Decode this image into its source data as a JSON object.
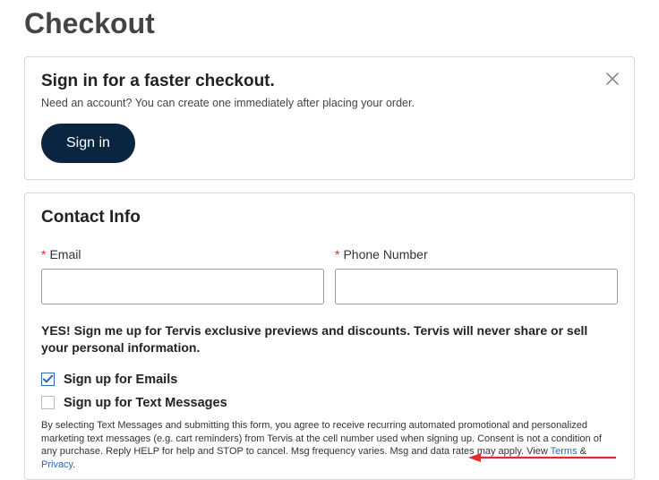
{
  "page_title": "Checkout",
  "signin_panel": {
    "title": "Sign in for a faster checkout.",
    "subtitle": "Need an account? You can create one immediately after placing your order.",
    "button_label": "Sign in"
  },
  "contact": {
    "section_title": "Contact Info",
    "required_mark": "*",
    "email": {
      "label": "Email",
      "value": ""
    },
    "phone": {
      "label": "Phone Number",
      "value": ""
    }
  },
  "optin": {
    "heading": "YES! Sign me up for Tervis exclusive previews and discounts. Tervis will never share or sell your personal information.",
    "email_label": "Sign up for Emails",
    "email_checked": true,
    "text_label": "Sign up for Text Messages",
    "text_checked": false,
    "legal_pre": "By selecting Text Messages and submitting this form, you agree to receive recurring automated promotional and personalized marketing text messages (e.g. cart reminders) from Tervis at the cell number used when signing up. Consent is not a condition of any purchase. Reply HELP for help and STOP to cancel. Msg frequency varies. Msg and data rates may apply. View ",
    "terms_label": "Terms",
    "amp": " & ",
    "privacy_label": "Privacy",
    "legal_post": "."
  },
  "colors": {
    "accent_navy": "#0a2540",
    "link": "#2b6cb0",
    "required": "#d42d2d",
    "annotation_red": "#e22c2c"
  }
}
